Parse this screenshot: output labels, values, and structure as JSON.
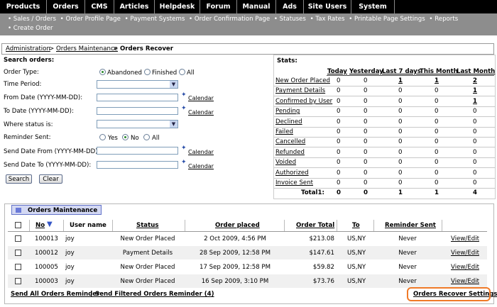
{
  "topnav": [
    "Products",
    "Orders",
    "CMS",
    "Articles",
    "Helpdesk",
    "Forum",
    "Manual",
    "Ads",
    "Site Users",
    "System"
  ],
  "subnav": {
    "line1": [
      "• Sales / Orders",
      "• Order Profile Page",
      "• Payment Systems",
      "• Order Confirmation Page",
      "• Statuses",
      "• Tax Rates",
      "• Printable Page Settings",
      "• Reports"
    ],
    "line2": [
      "• Create Order"
    ]
  },
  "breadcrumb": {
    "a": "Administration",
    "sep1": ">",
    "b": "Orders Maintenance",
    "sep2": ">",
    "c": "Orders Recover"
  },
  "search": {
    "title": "Search orders:",
    "order_type": "Order Type:",
    "opt_abandoned": "Abandoned",
    "opt_finished": "Finished",
    "opt_all": "All",
    "time_period": "Time Period:",
    "from_date": "From Date (YYYY-MM-DD):",
    "to_date": "To Date (YYYY-MM-DD):",
    "where_status": "Where status is:",
    "reminder_sent": "Reminder Sent:",
    "opt_yes": "Yes",
    "opt_no": "No",
    "opt_all2": "All",
    "send_from": "Send Date From (YYYY-MM-DD):",
    "send_to": "Send Date To (YYYY-MM-DD):",
    "calendar": "Calendar",
    "search_btn": "Search",
    "clear_btn": "Clear"
  },
  "stats": {
    "title": "Stats:",
    "cols": [
      "Today",
      "Yesterday",
      "Last 7 days",
      "This Month",
      "Last Month"
    ],
    "rows": [
      {
        "name": "New Order Placed",
        "v": [
          "0",
          "0",
          "1",
          "1",
          "2"
        ],
        "link": [
          false,
          false,
          true,
          true,
          true
        ]
      },
      {
        "name": "Payment Details",
        "v": [
          "0",
          "0",
          "0",
          "0",
          "1"
        ],
        "link": [
          false,
          false,
          false,
          false,
          true
        ]
      },
      {
        "name": "Confirmed by User",
        "v": [
          "0",
          "0",
          "0",
          "0",
          "1"
        ],
        "link": [
          false,
          false,
          false,
          false,
          true
        ]
      },
      {
        "name": "Pending",
        "v": [
          "0",
          "0",
          "0",
          "0",
          "0"
        ],
        "link": [
          false,
          false,
          false,
          false,
          false
        ]
      },
      {
        "name": "Declined",
        "v": [
          "0",
          "0",
          "0",
          "0",
          "0"
        ],
        "link": [
          false,
          false,
          false,
          false,
          false
        ]
      },
      {
        "name": "Failed",
        "v": [
          "0",
          "0",
          "0",
          "0",
          "0"
        ],
        "link": [
          false,
          false,
          false,
          false,
          false
        ]
      },
      {
        "name": "Cancelled",
        "v": [
          "0",
          "0",
          "0",
          "0",
          "0"
        ],
        "link": [
          false,
          false,
          false,
          false,
          false
        ]
      },
      {
        "name": "Refunded",
        "v": [
          "0",
          "0",
          "0",
          "0",
          "0"
        ],
        "link": [
          false,
          false,
          false,
          false,
          false
        ]
      },
      {
        "name": "Voided",
        "v": [
          "0",
          "0",
          "0",
          "0",
          "0"
        ],
        "link": [
          false,
          false,
          false,
          false,
          false
        ]
      },
      {
        "name": "Authorized",
        "v": [
          "0",
          "0",
          "0",
          "0",
          "0"
        ],
        "link": [
          false,
          false,
          false,
          false,
          false
        ]
      },
      {
        "name": "Invoice Sent",
        "v": [
          "0",
          "0",
          "0",
          "0",
          "0"
        ],
        "link": [
          false,
          false,
          false,
          false,
          false
        ]
      }
    ],
    "total_label": "Total1:",
    "total": [
      "0",
      "0",
      "1",
      "1",
      "4"
    ]
  },
  "orders": {
    "title": "Orders Maintenance",
    "cols": {
      "no": "No",
      "user": "User name",
      "status": "Status",
      "placed": "Order placed",
      "total": "Order Total",
      "to": "To",
      "reminder": "Reminder Sent"
    },
    "sort_icon": "sort-desc-icon",
    "rows": [
      {
        "no": "100013",
        "user": "joy",
        "status": "New Order Placed",
        "placed": "2 Oct 2009, 4:56 PM",
        "total": "$213.08",
        "to": "US,NY",
        "reminder": "Never",
        "action": "View/Edit"
      },
      {
        "no": "100012",
        "user": "joy",
        "status": "Payment Details",
        "placed": "28 Sep 2009, 12:58 PM",
        "total": "$147.61",
        "to": "US,NY",
        "reminder": "Never",
        "action": "View/Edit"
      },
      {
        "no": "100005",
        "user": "joy",
        "status": "New Order Placed",
        "placed": "17 Sep 2009, 12:58 PM",
        "total": "$59.82",
        "to": "US,NY",
        "reminder": "Never",
        "action": "View/Edit"
      },
      {
        "no": "100003",
        "user": "joy",
        "status": "New Order Placed",
        "placed": "16 Sep 2009, 3:10 PM",
        "total": "$73.76",
        "to": "US,NY",
        "reminder": "Never",
        "action": "View/Edit"
      }
    ],
    "send_all": "Send All Orders Reminder",
    "sep": "|",
    "send_filtered": "Send Filtered Orders Reminder (4)",
    "settings": "Orders Recover Settings"
  }
}
